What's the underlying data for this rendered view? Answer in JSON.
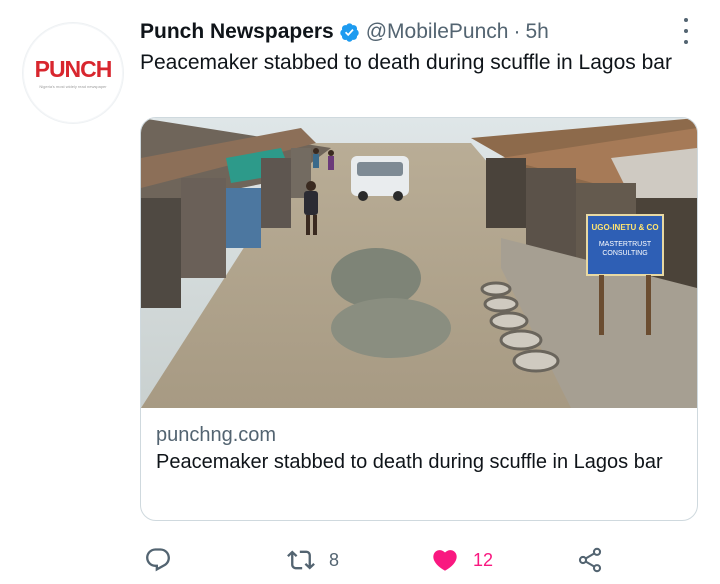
{
  "profile": {
    "logo_text": "PUNCH",
    "logo_tagline": "Nigeria's most widely read newspaper"
  },
  "tweet": {
    "display_name": "Punch Newspapers",
    "handle": "@MobilePunch",
    "separator": "·",
    "time": "5h",
    "text": "Peacemaker stabbed to death during scuffle in Lagos bar"
  },
  "card": {
    "domain": "punchng.com",
    "title": "Peacemaker stabbed to death during scuffle in Lagos bar",
    "image": {
      "description_sign": "UGO-INETU & CO",
      "sign_line2": "MASTERTRUST",
      "sign_line3": "CONSULTING"
    }
  },
  "actions": {
    "reply_count": "",
    "retweet_count": "8",
    "like_count": "12",
    "share_count": ""
  },
  "colors": {
    "accent": "#1d9bf0",
    "like": "#f91880",
    "brand": "#d8262e",
    "muted": "#536471"
  }
}
